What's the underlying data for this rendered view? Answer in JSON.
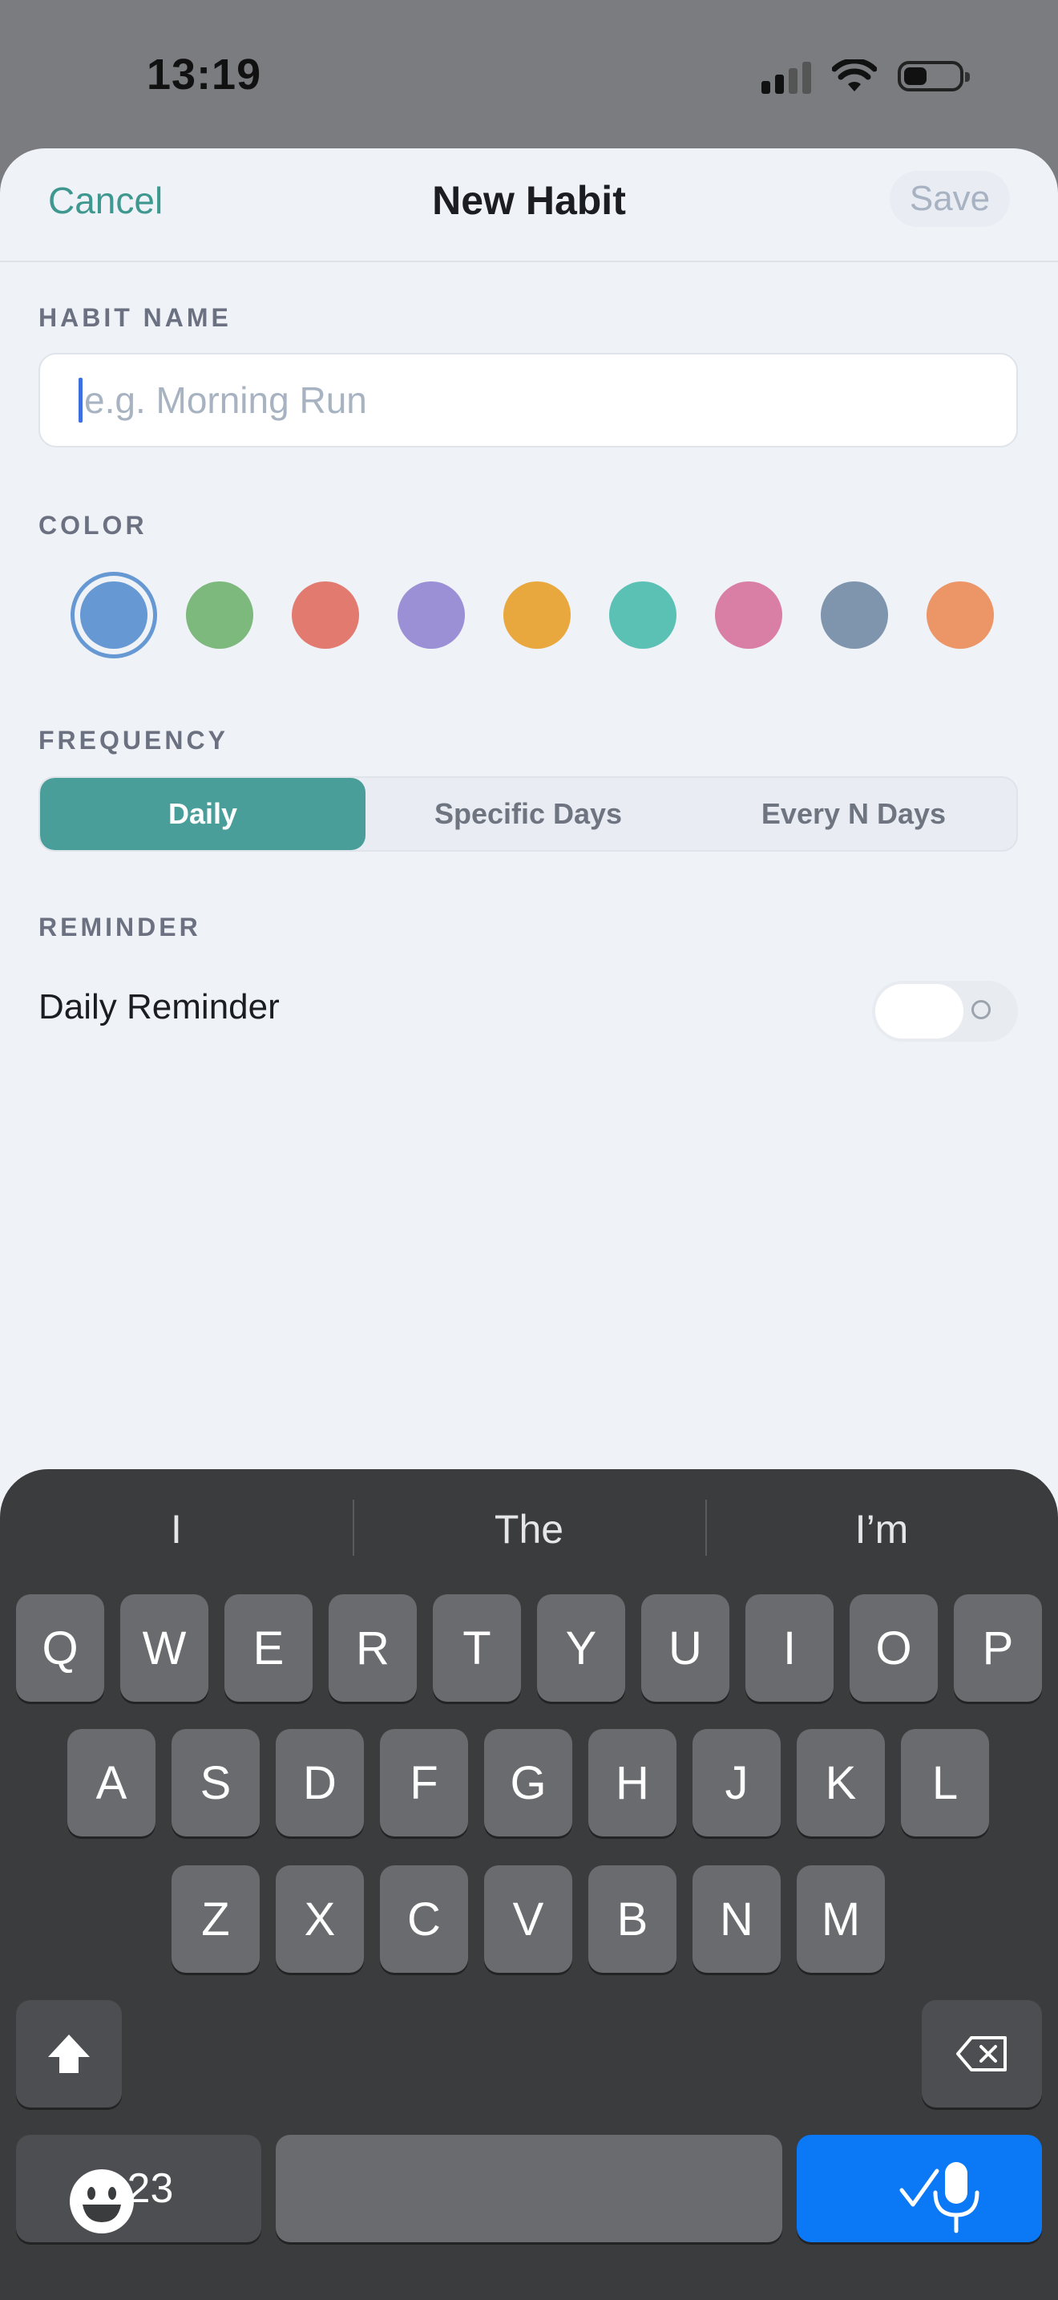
{
  "status_bar": {
    "time": "13:19"
  },
  "nav": {
    "cancel": "Cancel",
    "title": "New Habit",
    "save": "Save"
  },
  "habit_name": {
    "label": "HABIT NAME",
    "placeholder": "e.g. Morning Run",
    "value": ""
  },
  "color": {
    "label": "COLOR",
    "swatches": [
      "#6699d3",
      "#7db87d",
      "#e37a70",
      "#9b8fd6",
      "#e9a83e",
      "#5bc1b5",
      "#d97fa6",
      "#7f95ad",
      "#ec9567"
    ],
    "selected_index": 0
  },
  "frequency": {
    "label": "FREQUENCY",
    "options": [
      "Daily",
      "Specific Days",
      "Every N Days"
    ],
    "selected": "Daily"
  },
  "reminder": {
    "label": "REMINDER",
    "row_label": "Daily Reminder",
    "enabled": false
  },
  "keyboard": {
    "suggestions": [
      "I",
      "The",
      "I’m"
    ],
    "row1": [
      "Q",
      "W",
      "E",
      "R",
      "T",
      "Y",
      "U",
      "I",
      "O",
      "P"
    ],
    "row2": [
      "A",
      "S",
      "D",
      "F",
      "G",
      "H",
      "J",
      "K",
      "L"
    ],
    "row3": [
      "Z",
      "X",
      "C",
      "V",
      "B",
      "N",
      "M"
    ],
    "numbers_key": "123",
    "return_icon": "checkmark-icon"
  }
}
